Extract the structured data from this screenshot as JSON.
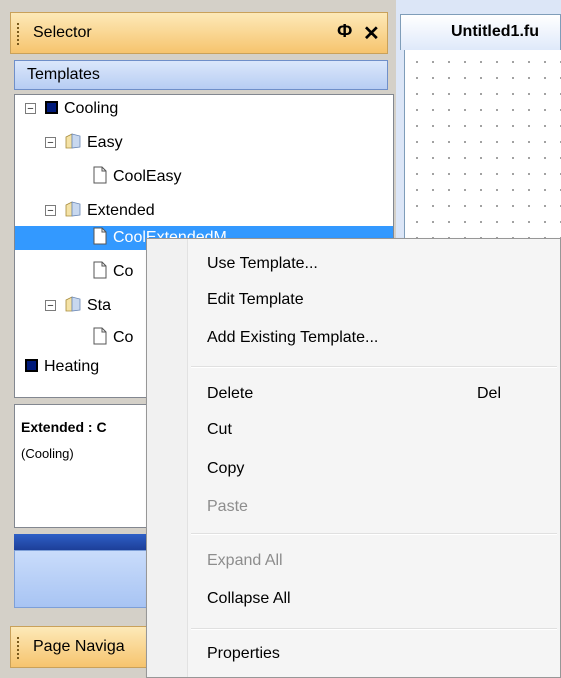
{
  "selector": {
    "title": "Selector",
    "pin": "Ф",
    "close": "✕"
  },
  "templates_header": "Templates",
  "tree": [
    {
      "label": "Cooling",
      "icon": "navy-square-icon"
    },
    {
      "label": "Easy",
      "icon": "folder-icon"
    },
    {
      "label": "CoolEasy",
      "icon": "document-icon"
    },
    {
      "label": "Extended",
      "icon": "folder-icon"
    },
    {
      "label": "CoolExtendedM",
      "icon": "document-icon"
    },
    {
      "label": "Co",
      "icon": "document-icon"
    },
    {
      "label": "Sta",
      "icon": "folder-icon"
    },
    {
      "label": "Co",
      "icon": "document-icon"
    },
    {
      "label": "Heating",
      "icon": "navy-square-icon"
    }
  ],
  "description": {
    "title": "Extended : C",
    "subtitle": "(Cooling)"
  },
  "page_navigator": {
    "title": "Page Naviga"
  },
  "document_tab": {
    "label": "Untitled1.fu"
  },
  "context_menu": {
    "items": [
      {
        "label": "Use Template...",
        "enabled": true
      },
      {
        "label": "Edit Template",
        "enabled": true
      },
      {
        "label": "Add Existing Template...",
        "enabled": true
      },
      {
        "label": "Delete",
        "shortcut": "Del",
        "enabled": true
      },
      {
        "label": "Cut",
        "enabled": true
      },
      {
        "label": "Copy",
        "enabled": true
      },
      {
        "label": "Paste",
        "enabled": false
      },
      {
        "label": "Expand All",
        "enabled": false
      },
      {
        "label": "Collapse All",
        "enabled": true
      },
      {
        "label": "Properties",
        "enabled": true
      }
    ]
  },
  "colors": {
    "selection": "#3399ff",
    "panel_title": "#f6c46e",
    "dark_blue": "#001a7a"
  }
}
